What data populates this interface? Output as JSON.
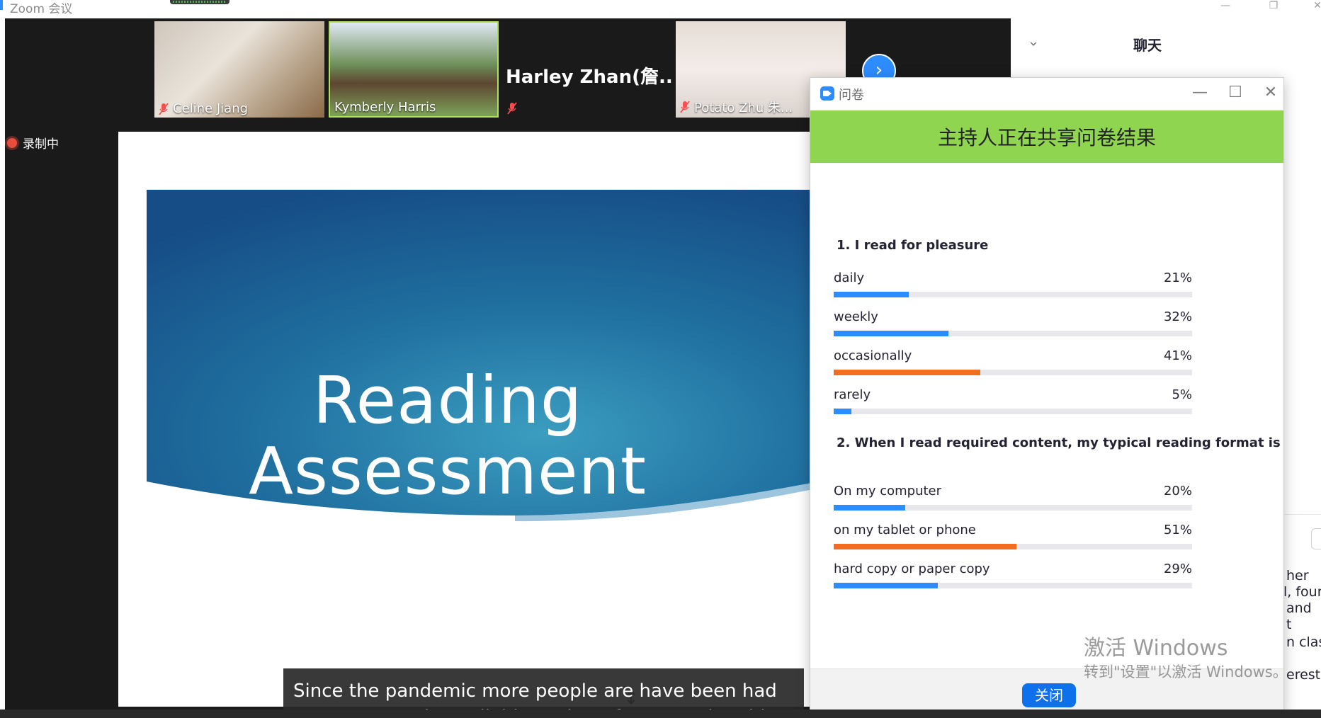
{
  "app": {
    "title": "Zoom 会议"
  },
  "window_controls": {
    "minimize": "—",
    "restore": "❐",
    "close": "✕"
  },
  "participants": [
    {
      "name": "Celine Jiang",
      "muted": true
    },
    {
      "name": "Kymberly Harris",
      "muted": true
    },
    {
      "name": "Harley  Zhan(詹...",
      "muted": true
    },
    {
      "name": "Potato Zhu 朱...",
      "muted": true
    }
  ],
  "next_page_symbol": "›",
  "recording": {
    "label": "录制中"
  },
  "slide": {
    "title_line1": "Reading",
    "title_line2": "Assessment"
  },
  "caption": {
    "line1": "Since the pandemic more people are have been had",
    "line2": "resources made available to them for example tablets"
  },
  "chat": {
    "title": "聊天",
    "visible_fragments": [
      "her",
      "l, four",
      "and",
      "t",
      "n class",
      "erested"
    ]
  },
  "poll": {
    "window_title": "问卷",
    "header": "主持人正在共享问卷结果",
    "questions": [
      {
        "title": "1. I read for pleasure",
        "answers": [
          {
            "label": "daily",
            "percent_text": "21%",
            "fraction": 0.21,
            "color": "#2d8cff"
          },
          {
            "label": "weekly",
            "percent_text": "32%",
            "fraction": 0.32,
            "color": "#2d8cff"
          },
          {
            "label": "occasionally",
            "percent_text": "41%",
            "fraction": 0.41,
            "color": "#f26d21"
          },
          {
            "label": "rarely",
            "percent_text": "5%",
            "fraction": 0.05,
            "color": "#2d8cff"
          }
        ]
      },
      {
        "title": "2. When I read required content, my typical reading format is",
        "answers": [
          {
            "label": "On my computer",
            "percent_text": "20%",
            "fraction": 0.2,
            "color": "#2d8cff"
          },
          {
            "label": "on my tablet or phone",
            "percent_text": "51%",
            "fraction": 0.51,
            "color": "#f26d21"
          },
          {
            "label": "hard copy or paper copy",
            "percent_text": "29%",
            "fraction": 0.29,
            "color": "#2d8cff"
          }
        ]
      }
    ],
    "close_label": "关闭"
  },
  "watermark": {
    "line1": "激活 Windows",
    "line2": "转到\"设置\"以激活 Windows。"
  },
  "colors": {
    "accent": "#2d8cff",
    "poll_header": "#8fd550",
    "highlight_bar": "#f26d21"
  }
}
